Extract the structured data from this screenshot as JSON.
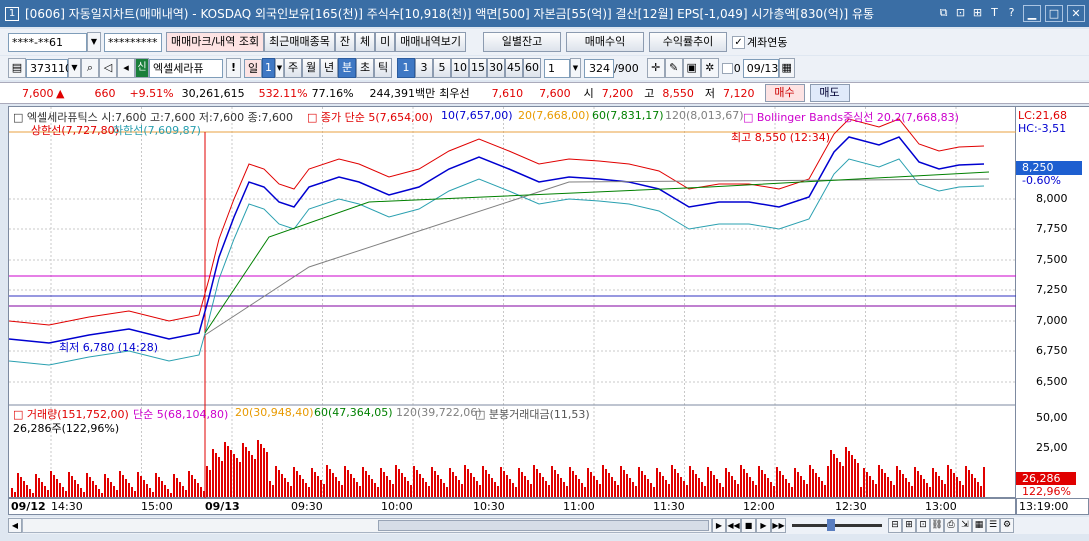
{
  "window": {
    "number": "1",
    "title": "[0606] 자동일지차트(매매내역) - KOSDAQ 외국인보유[165(천)] 주식수[10,918(천)] 액면[500] 자본금[55(억)] 결산[12월] EPS[-1,049] 시가총액[830(억)] 유통",
    "tool_icons": [
      "⧉",
      "⊡",
      "⊞",
      "T",
      "?"
    ],
    "controls": [
      "▁",
      "□",
      "✕"
    ]
  },
  "toolbar1": {
    "account": "****-**61",
    "password": "*********",
    "btn_mark": "매매마크/내역 조회",
    "btn_recent": "최근매매종목",
    "btn_jan": "잔",
    "btn_che": "체",
    "btn_mi": "미",
    "btn_view": "매매내역보기",
    "btn_daily": "일별잔고",
    "btn_profit": "매매수익",
    "btn_rate": "수익률추이",
    "chk_link": "계좌연동"
  },
  "toolbar2": {
    "code": "373110",
    "badge": "신",
    "stock_name": "엑셀세라퓨",
    "excl": "!",
    "period_sel": "일",
    "period_num": "1",
    "periods": [
      "주",
      "월",
      "년",
      "분",
      "초",
      "틱"
    ],
    "nums": [
      "1",
      "3",
      "5",
      "10",
      "15",
      "30",
      "45",
      "60"
    ],
    "count": "1",
    "display": "324",
    "total": "/900",
    "chk_zero": "0",
    "date": "09/13"
  },
  "quote": {
    "price": "7,600",
    "arrow": "▲",
    "change": "660",
    "rate": "+9.51%",
    "volume": "30,261,615",
    "vol_rate": "532.11%",
    "ratio": "77.16%",
    "amount": "244,391백만",
    "pref_label": "최우선",
    "pref1": "7,610",
    "pref2": "7,600",
    "open_l": "시",
    "open": "7,200",
    "high_l": "고",
    "high": "8,550",
    "low_l": "저",
    "low": "7,120",
    "buy": "매수",
    "sell": "매도"
  },
  "price_panel": {
    "legend_name": "엑셀세라퓨틱스 시:7,600 고:7,600 저:7,600 종:7,600",
    "ma_title": "종가 단순 5(7,654,00)",
    "ma10": "10(7,657,00)",
    "ma20": "20(7,668,00)",
    "ma60": "60(7,831,17)",
    "ma120": "120(8,013,67)",
    "bb": "Bollinger Bands중심선 20,2(7,668,83)",
    "upper": "상한선(7,727,80)",
    "lower": "하한선(7,609,87)",
    "high_note": "최고 8,550 (12:34)",
    "low_note": "최저 6,780 (14:28)",
    "axis_lc": "LC:21,68",
    "axis_hc": "HC:-3,51",
    "current": "8,250",
    "current_rate": "-0.60%",
    "ticks": [
      "8,000",
      "7,750",
      "7,500",
      "7,250",
      "7,000",
      "6,750",
      "6,500"
    ]
  },
  "vol_panel": {
    "label": "거래량(151,752,00)",
    "ma5": "단순 5(68,104,80)",
    "ma20": "20(30,948,40)",
    "ma60": "60(47,364,05)",
    "ma120": "120(39,722,06)",
    "amt": "분봉거래대금(11,53)",
    "sub": "26,286주(122,96%)",
    "ticks": [
      "50,00",
      "25,00"
    ],
    "current": "26,286",
    "current_rate": "122,96%"
  },
  "xaxis": {
    "labels": [
      "09/12",
      "14:30",
      "15:00",
      "09/13",
      "09:30",
      "10:00",
      "10:30",
      "11:00",
      "11:30",
      "12:00",
      "12:30",
      "13:00"
    ],
    "right": "13:19:00"
  },
  "colors": {
    "titlebar": "#3a6ea5",
    "up": "#e00000",
    "down": "#0000d0",
    "ma5": "#e00000",
    "ma10": "#0000d0",
    "ma20": "#e89a00",
    "ma60": "#008000",
    "ma120": "#808080",
    "bb": "#cc00cc"
  }
}
